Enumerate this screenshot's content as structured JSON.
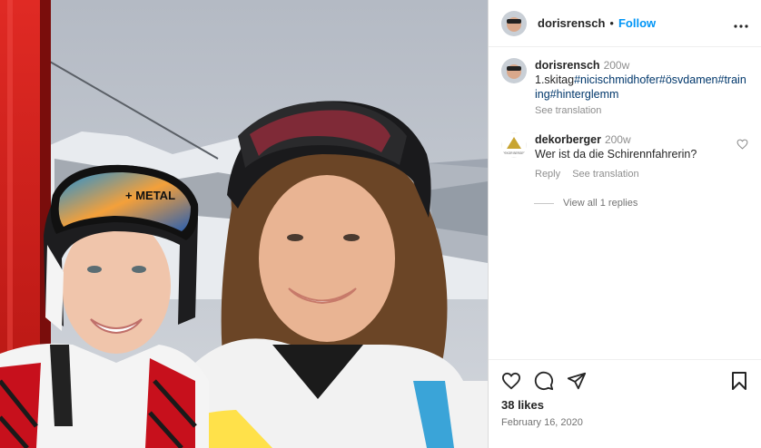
{
  "header": {
    "username": "dorisrensch",
    "separator": "•",
    "follow_label": "Follow",
    "more_icon": "more-horizontal-icon"
  },
  "caption": {
    "username": "dorisrensch",
    "time": "200w",
    "text_prefix": "1.skitag",
    "hashtags_line1": "#nicischmidhofer#ösvdamen#train",
    "hashtags_line2": "ing#hinterglemm",
    "see_translation": "See translation"
  },
  "comment": {
    "username": "dekorberger",
    "time": "200w",
    "text": "Wer ist da die Schirennfahrerin?",
    "reply": "Reply",
    "see_translation": "See translation",
    "view_replies": "View all 1 replies",
    "avatar_text": "DEKOR BERGER"
  },
  "footer": {
    "likes": "38 likes",
    "date": "February 16, 2020"
  },
  "photo": {
    "goggle_brand_text": "+ METAL"
  },
  "colors": {
    "accent": "#0095f6",
    "hashtag": "#00376b",
    "muted": "#8e8e8e",
    "gondola": "#d8201f"
  }
}
